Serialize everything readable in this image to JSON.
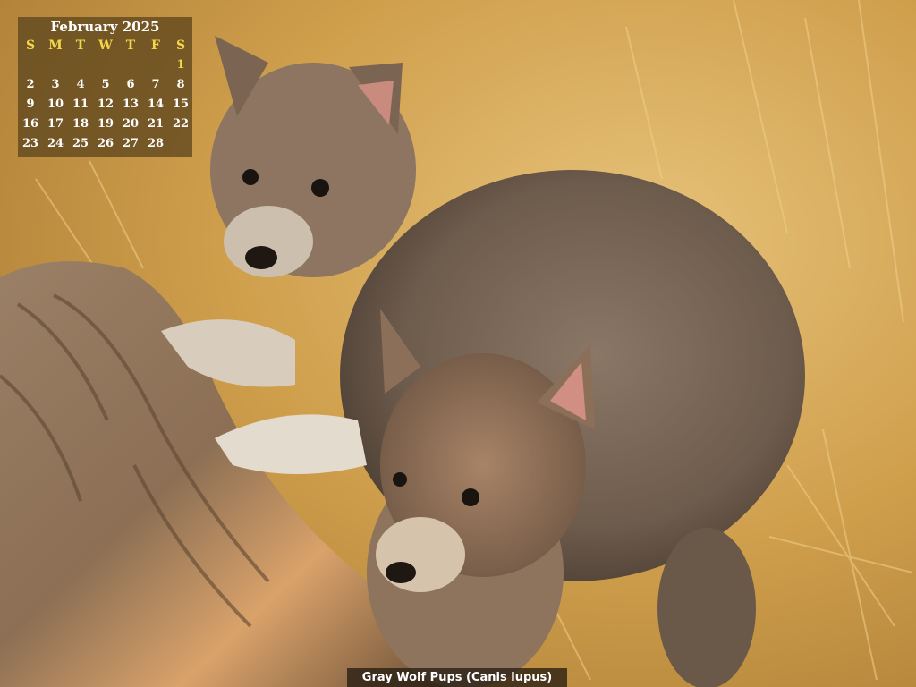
{
  "calendar": {
    "title": "February 2025",
    "weekday_headers": [
      "S",
      "M",
      "T",
      "W",
      "T",
      "F",
      "S"
    ],
    "leading_blank_days": 6,
    "days": [
      1,
      2,
      3,
      4,
      5,
      6,
      7,
      8,
      9,
      10,
      11,
      12,
      13,
      14,
      15,
      16,
      17,
      18,
      19,
      20,
      21,
      22,
      23,
      24,
      25,
      26,
      27,
      28
    ],
    "header_color": "#f3d64a",
    "highlight_color": "#f3d64a",
    "highlighted_day": 1
  },
  "caption": "Gray Wolf Pups (Canis lupus)",
  "photo": {
    "subject": "two gray wolf pups climbing on a weathered log",
    "background_color": "#c9993f",
    "fur_color": "#7a6552"
  }
}
